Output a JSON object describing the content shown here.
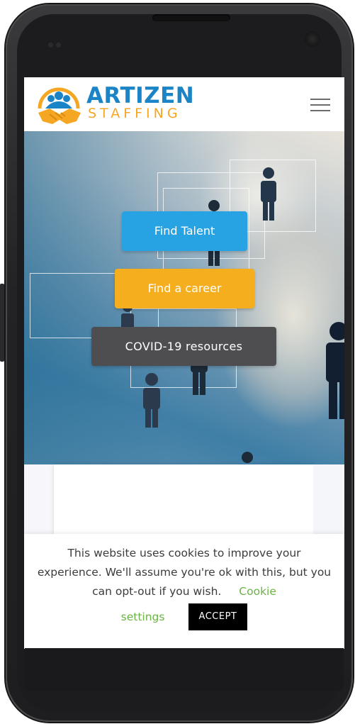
{
  "header": {
    "brand_name": "ARTIZEN",
    "brand_sub": "STAFFING",
    "brand_color": "#1a84c6",
    "accent_color": "#f5a623",
    "menu_icon": "hamburger-menu-icon"
  },
  "hero": {
    "buttons": {
      "find_talent": "Find Talent",
      "find_career": "Find a career",
      "covid": "COVID-19 resources"
    },
    "colors": {
      "find_talent": "#27a3e3",
      "find_career": "#f5ae1e",
      "covid": "#4e4e50"
    }
  },
  "cookie": {
    "message": "This website uses cookies to improve your experience. We'll assume you're ok with this, but you can opt-out if you wish.",
    "link_part1": "Cookie",
    "link_part2": "settings",
    "accept_label": "ACCEPT",
    "link_color": "#6ab344"
  }
}
